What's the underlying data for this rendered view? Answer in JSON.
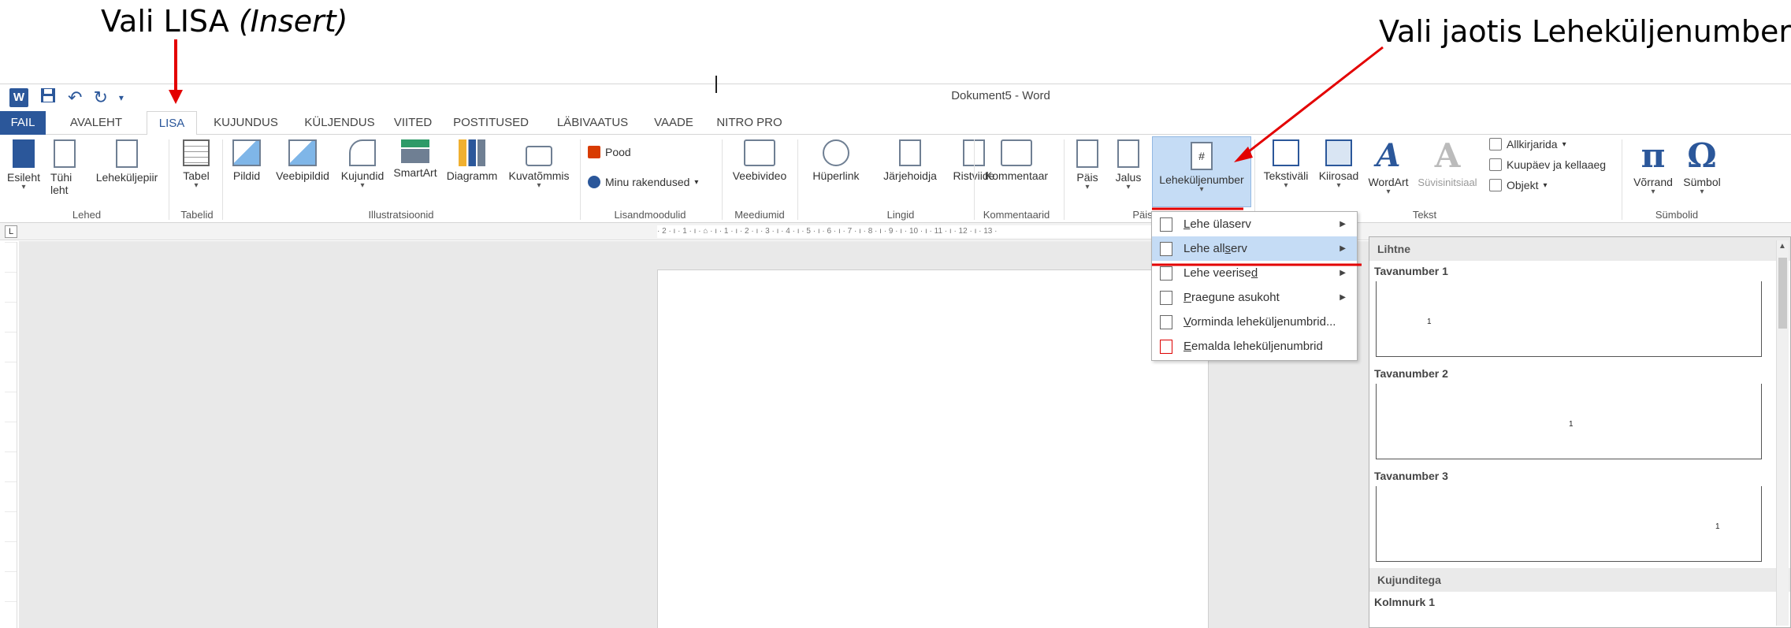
{
  "annotations": {
    "left_prefix": "Vali LISA ",
    "left_italic": "(Insert)",
    "right": "Vali jaotis Leheküljenumber"
  },
  "title_bar": {
    "title": "Dokument5 - Word",
    "qat": {
      "logo": "W",
      "save_icon": "save-icon",
      "undo": "↶",
      "redo": "↻"
    }
  },
  "tabs": [
    "FAIL",
    "AVALEHT",
    "LISA",
    "KUJUNDUS",
    "KÜLJENDUS",
    "VIITED",
    "POSTITUSED",
    "LÄBIVAATUS",
    "VAADE",
    "NITRO PRO"
  ],
  "ribbon": {
    "buttons": {
      "esileht": "Esileht",
      "tuhi_leht_1": "Tühi",
      "tuhi_leht_2": "leht",
      "lehekuljepiir": "Leheküljepiir",
      "tabel": "Tabel",
      "pildid": "Pildid",
      "veebipildid": "Veebipildid",
      "kujundid": "Kujundid",
      "smartart": "SmartArt",
      "diagramm": "Diagramm",
      "kuvatommis": "Kuvatõmmis",
      "pood": "Pood",
      "minu_rakendused": "Minu rakendused",
      "veebivideo": "Veebivideo",
      "huperlink": "Hüperlink",
      "jarjehoidja": "Järjehoidja",
      "ristviide": "Ristviide",
      "kommentaar": "Kommentaar",
      "pais": "Päis",
      "jalus": "Jalus",
      "lehekuljenumber": "Leheküljenumber",
      "tekstivali": "Tekstiväli",
      "kiirosad": "Kiirosad",
      "wordart": "WordArt",
      "suvisinitsiaal": "Süvisinitsiaal",
      "allkirjarida": "Allkirjarida",
      "kuupaev": "Kuupäev ja kellaaeg",
      "objekt": "Objekt",
      "vorrand": "Võrrand",
      "sumbol": "Sümbol",
      "pi_glyph": "π",
      "omega_glyph": "Ω",
      "wordart_glyph": "A",
      "hash_glyph": "#"
    },
    "groups": {
      "lehed": "Lehed",
      "tabelid": "Tabelid",
      "illustratsioonid": "Illustratsioonid",
      "lisandmoodulid": "Lisandmoodulid",
      "meediumid": "Meediumid",
      "lingid": "Lingid",
      "kommentaarid": "Kommentaarid",
      "pais": "Päis",
      "tekst": "Tekst",
      "sumbolid": "Sümbolid"
    }
  },
  "ruler": {
    "corner": "L",
    "ticks": "· 2 · ı · 1 · ı · ⌂ · ı · 1 · ı · 2 · ı · 3 · ı · 4 · ı · 5 · ı · 6 · ı · 7 · ı · 8 · ı · 9 · ı · 10 · ı · 11 · ı · 12 · ı · 13 ·"
  },
  "page_number_menu": {
    "items": [
      {
        "before": "",
        "u": "L",
        "after": "ehe ülaserv",
        "has_submenu": true
      },
      {
        "before": "Lehe all",
        "u": "s",
        "after": "erv",
        "has_submenu": true,
        "highlighted": true
      },
      {
        "before": "Lehe veerise",
        "u": "d",
        "after": "",
        "has_submenu": true
      },
      {
        "before": "",
        "u": "P",
        "after": "raegune asukoht",
        "has_submenu": true
      },
      {
        "before": "",
        "u": "V",
        "after": "orminda leheküljenumbrid...",
        "has_submenu": false
      },
      {
        "before": "",
        "u": "E",
        "after": "emalda leheküljenumbrid",
        "has_submenu": false
      }
    ]
  },
  "gallery": {
    "category_1": "Lihtne",
    "items": [
      {
        "name": "Tavanumber 1",
        "number": "1"
      },
      {
        "name": "Tavanumber 2",
        "number": "1"
      },
      {
        "name": "Tavanumber 3",
        "number": "1"
      }
    ],
    "category_2": "Kujunditega",
    "item_4": "Kolmnurk 1"
  },
  "colors": {
    "accent": "#2b579a",
    "selected": "#c5dcf5",
    "annotation_arrow": "#e30000"
  }
}
